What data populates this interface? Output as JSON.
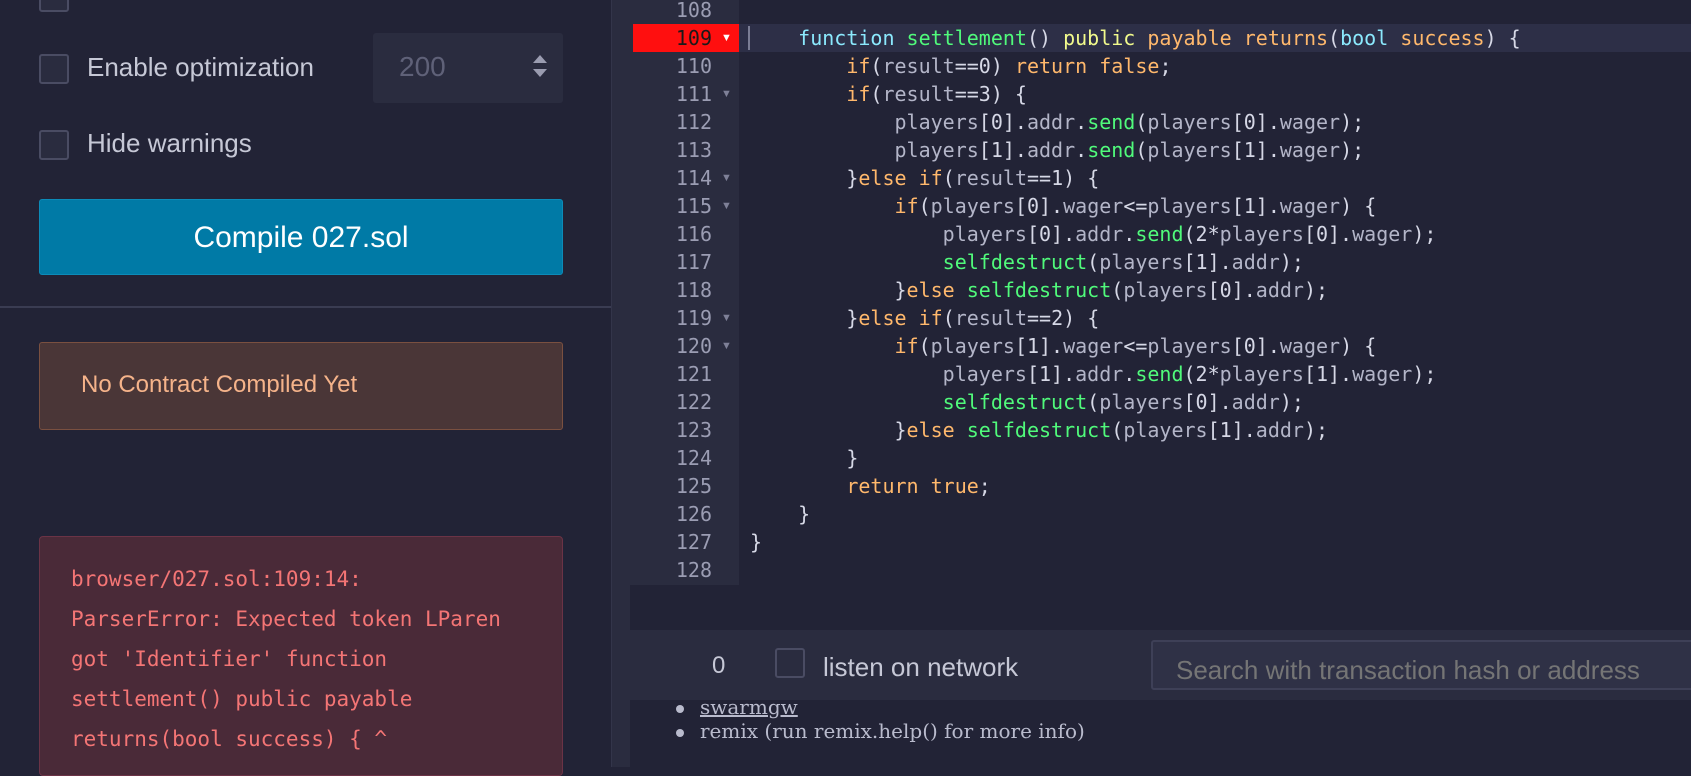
{
  "compiler": {
    "optimization_label": "Enable optimization",
    "runs_value": "200",
    "hide_warnings_label": "Hide warnings",
    "compile_button": "Compile 027.sol",
    "no_contract": "No Contract Compiled Yet",
    "error_lines": [
      "browser/027.sol:109:14:",
      "ParserError: Expected token LParen",
      "got 'Identifier' function",
      "settlement() public payable",
      "returns(bool success) { ^"
    ]
  },
  "editor": {
    "error_line": "109",
    "line_numbers": [
      "108",
      "109",
      "110",
      "111",
      "112",
      "113",
      "114",
      "115",
      "116",
      "117",
      "118",
      "119",
      "120",
      "121",
      "122",
      "123",
      "124",
      "125",
      "126",
      "127",
      "128"
    ]
  },
  "terminal": {
    "tx_count": "0",
    "listen_label": "listen on network",
    "search_placeholder": "Search with transaction hash or address",
    "items": [
      "swarmgw",
      "remix (run remix.help() for more info)"
    ]
  },
  "colors": {
    "background": "#222336",
    "compile_button": "#007aa6",
    "error_text": "#f47575",
    "error_marker": "#ff0f0f"
  }
}
